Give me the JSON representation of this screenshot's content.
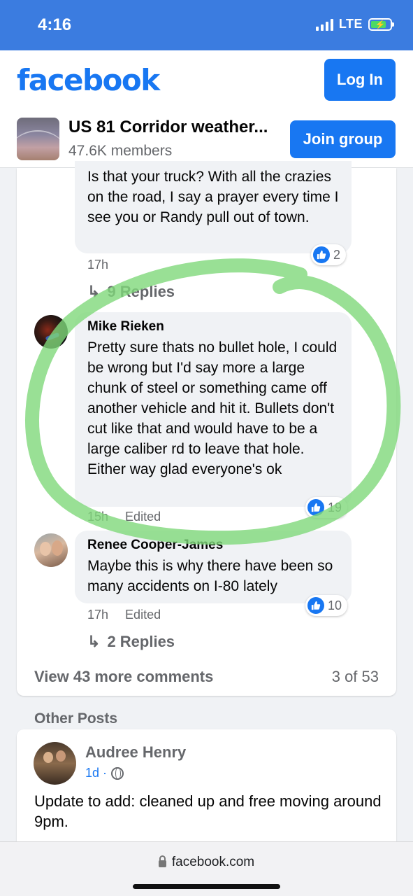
{
  "status_bar": {
    "time": "4:16",
    "network": "LTE"
  },
  "header": {
    "logo": "facebook",
    "login_label": "Log In"
  },
  "group": {
    "name": "US 81 Corridor weather...",
    "members": "47.6K members",
    "join_label": "Join group"
  },
  "comments": [
    {
      "text": "Is that your truck? With all the crazies on the road, I say a prayer every time I see you or Randy pull out of town.",
      "time": "17h",
      "likes": "2",
      "replies": "9 Replies"
    },
    {
      "author": "Mike Rieken",
      "text": "Pretty sure thats no bullet hole, I could be wrong but I'd say more a large chunk of steel or something came off another vehicle and hit it. Bullets don't cut like that and would have to be a large caliber rd to leave that hole. Either way glad everyone's ok",
      "time": "15h",
      "edited": "Edited",
      "likes": "19"
    },
    {
      "author": "Renee Cooper-James",
      "text": "Maybe this is why there have been so many accidents on I-80 lately",
      "time": "17h",
      "edited": "Edited",
      "likes": "10",
      "replies": "2 Replies"
    }
  ],
  "footer": {
    "view_more": "View 43 more comments",
    "count": "3 of 53"
  },
  "other_posts": {
    "title": "Other Posts",
    "post": {
      "author": "Audree Henry",
      "time": "1d ·",
      "text": "Update to add: cleaned up and free moving around 9pm."
    }
  },
  "browser": {
    "url": "facebook.com"
  },
  "colors": {
    "brand": "#1877f2",
    "status_bar": "#3b7ce0",
    "highlight": "#7fd87a"
  },
  "icons": [
    "like-icon",
    "reply-arrow-icon",
    "globe-icon",
    "lock-icon",
    "battery-icon",
    "signal-icon"
  ]
}
